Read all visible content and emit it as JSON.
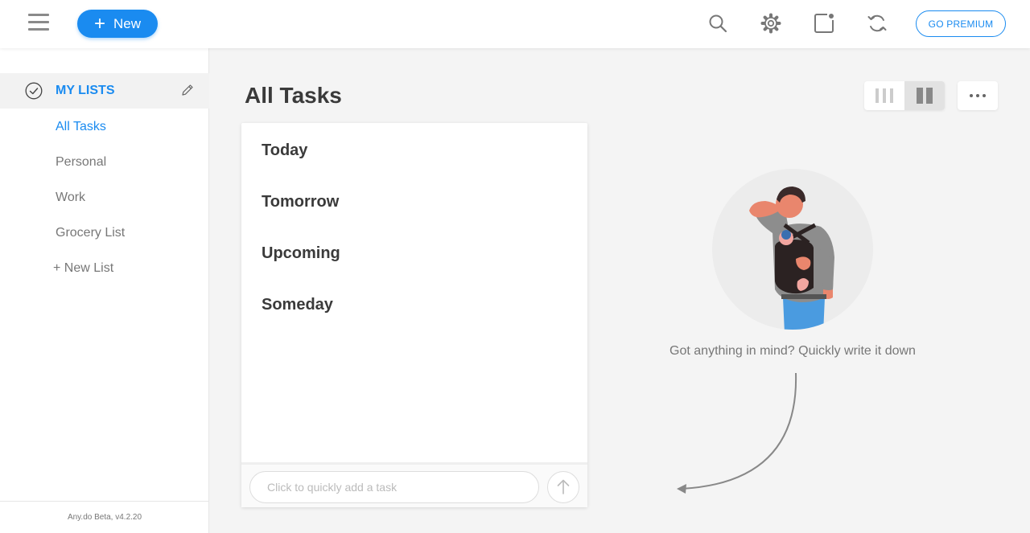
{
  "topbar": {
    "new_label": "New",
    "premium_label": "GO PREMIUM",
    "icons": [
      "menu-icon",
      "plus-icon",
      "search-icon",
      "gear-icon",
      "notification-icon",
      "sync-icon"
    ]
  },
  "sidebar": {
    "header": "MY LISTS",
    "items": [
      {
        "label": "All Tasks",
        "active": true
      },
      {
        "label": "Personal",
        "active": false
      },
      {
        "label": "Work",
        "active": false
      },
      {
        "label": "Grocery List",
        "active": false
      }
    ],
    "new_list": "+ New List",
    "footer": "Any.do Beta, v4.2.20"
  },
  "main": {
    "title": "All Tasks",
    "sections": [
      "Today",
      "Tomorrow",
      "Upcoming",
      "Someday"
    ],
    "quick_add_placeholder": "Click to quickly add a task",
    "hint": "Got anything in mind? Quickly write it down"
  },
  "colors": {
    "accent": "#1a8bf0",
    "background": "#f4f4f4",
    "text_dark": "#3a3a3a",
    "text_muted": "#777777"
  }
}
